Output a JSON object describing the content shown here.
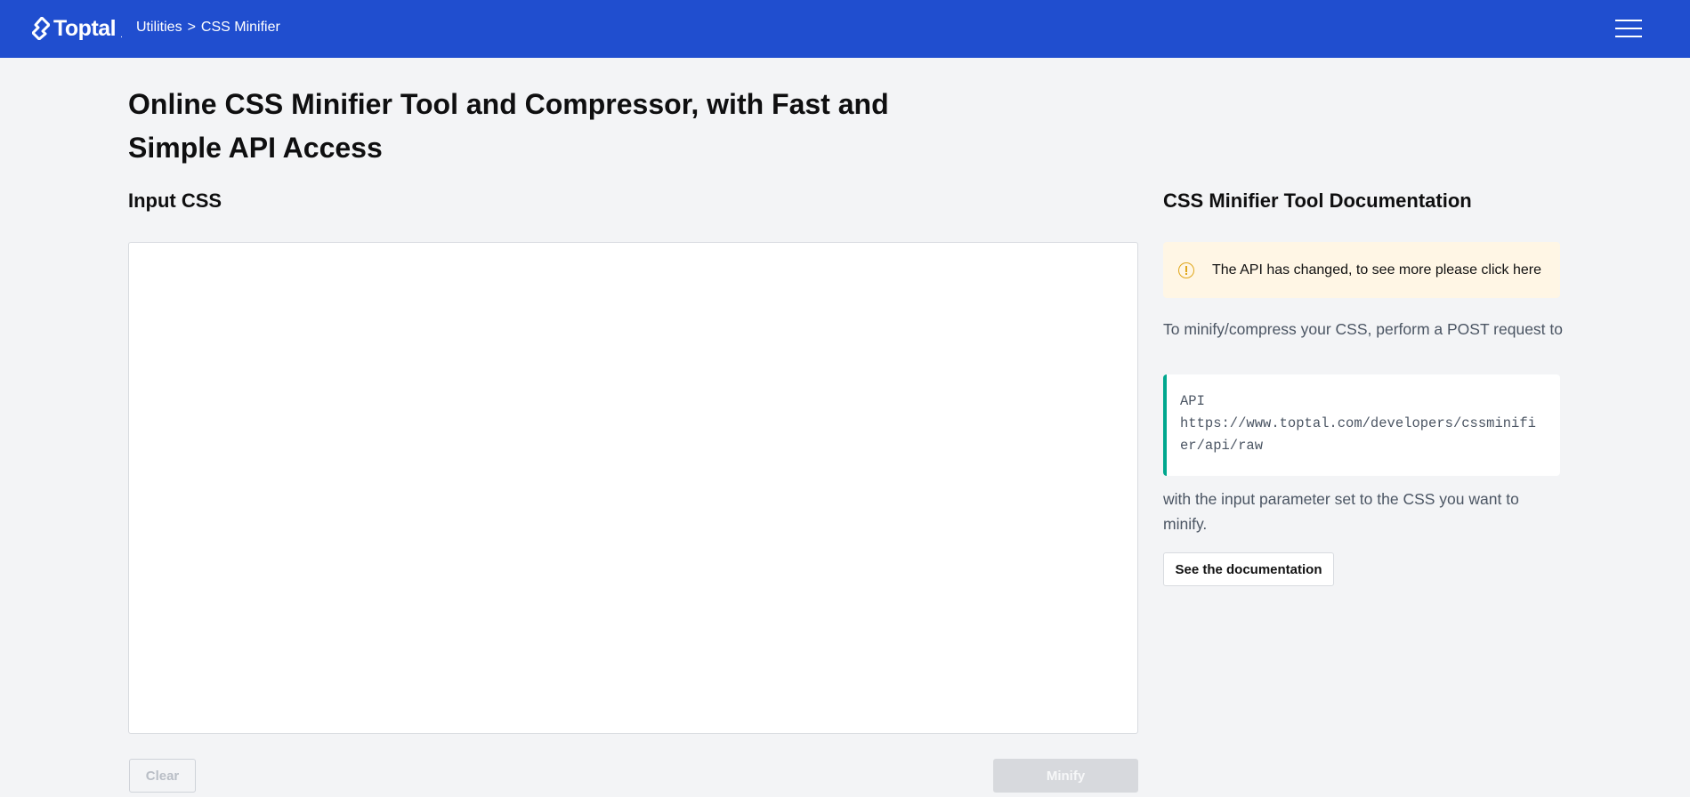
{
  "header": {
    "logo_text": "Toptal",
    "logo_suffix": ".",
    "breadcrumb": {
      "parent": "Utilities",
      "separator": ">",
      "current": "CSS Minifier"
    },
    "menu_icon": "hamburger-icon"
  },
  "main": {
    "title": "Online CSS Minifier Tool and Compressor, with Fast and Simple API Access",
    "input_section_title": "Input CSS",
    "input_value": "",
    "clear_label": "Clear",
    "minify_label": "Minify"
  },
  "docs": {
    "title": "CSS Minifier Tool Documentation",
    "notice_icon": "warning-circle-icon",
    "notice_text": "The API has changed, to see more please click here",
    "intro": "To minify/compress your CSS, perform a POST request to",
    "api_label": "API",
    "api_url": "https://www.toptal.com/developers/cssminifier/api/raw",
    "outro": "with the input parameter set to the CSS you want to minify.",
    "docs_button_label": "See the documentation"
  },
  "colors": {
    "header_bg": "#204ecf",
    "page_bg": "#f3f4f6",
    "notice_bg": "#fff6e5",
    "notice_icon": "#e0a61a",
    "code_accent": "#00a78e"
  }
}
